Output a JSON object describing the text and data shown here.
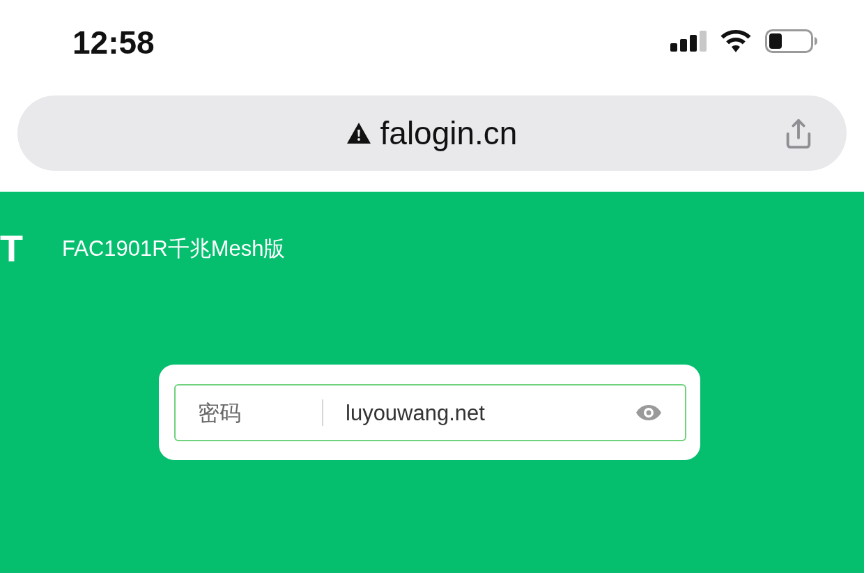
{
  "status_bar": {
    "time": "12:58"
  },
  "address_bar": {
    "url": "falogin.cn",
    "secure": false
  },
  "header": {
    "logo": "T",
    "title": "FAC1901R千兆Mesh版"
  },
  "login_form": {
    "field": {
      "label": "密码",
      "value": "luyouwang.net",
      "password_visible": true
    }
  }
}
